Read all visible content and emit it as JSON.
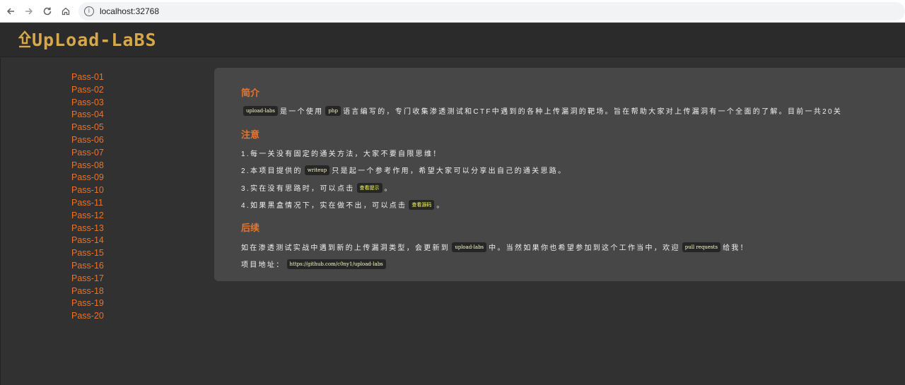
{
  "browser": {
    "url": "localhost:32768"
  },
  "header": {
    "logo_text": "UpLoad-LaBS"
  },
  "sidebar": {
    "items": [
      "Pass-01",
      "Pass-02",
      "Pass-03",
      "Pass-04",
      "Pass-05",
      "Pass-06",
      "Pass-07",
      "Pass-08",
      "Pass-09",
      "Pass-10",
      "Pass-11",
      "Pass-12",
      "Pass-13",
      "Pass-14",
      "Pass-15",
      "Pass-16",
      "Pass-17",
      "Pass-18",
      "Pass-19",
      "Pass-20"
    ]
  },
  "intro": {
    "title": "简介",
    "code1": "upload-labs",
    "text1": "是一个使用",
    "code2": "php",
    "text2": "语言编写的，专门收集渗透测试和CTF中遇到的各种上传漏洞的靶场。旨在帮助大家对上传漏洞有一个全面的了解。目前一共20关"
  },
  "notice": {
    "title": "注意",
    "item1": "1.每一关没有固定的通关方法，大家不要自限思维！",
    "item2_a": "2.本项目提供的",
    "item2_code": "writeup",
    "item2_b": "只是起一个参考作用，希望大家可以分享出自己的通关思路。",
    "item3_a": "3.实在没有思路时，可以点击",
    "item3_code": "查看提示",
    "item3_b": "。",
    "item4_a": "4.如果黑盒情况下，实在做不出，可以点击",
    "item4_code": "查看源码",
    "item4_b": "。"
  },
  "followup": {
    "title": "后续",
    "line1_a": "如在渗透测试实战中遇到新的上传漏洞类型，会更新到",
    "line1_code": "upload-labs",
    "line1_b": "中。当然如果你也希望参加到这个工作当中，欢迎",
    "line1_code2": "pull requests",
    "line1_c": "给我！",
    "addr_label": "项目地址：",
    "addr_url": "https://github.com/c0ny1/upload-labs"
  },
  "colors": {
    "accent": "#e8732a",
    "logo": "#d6a84a",
    "panel": "#474747",
    "background": "#313131"
  }
}
